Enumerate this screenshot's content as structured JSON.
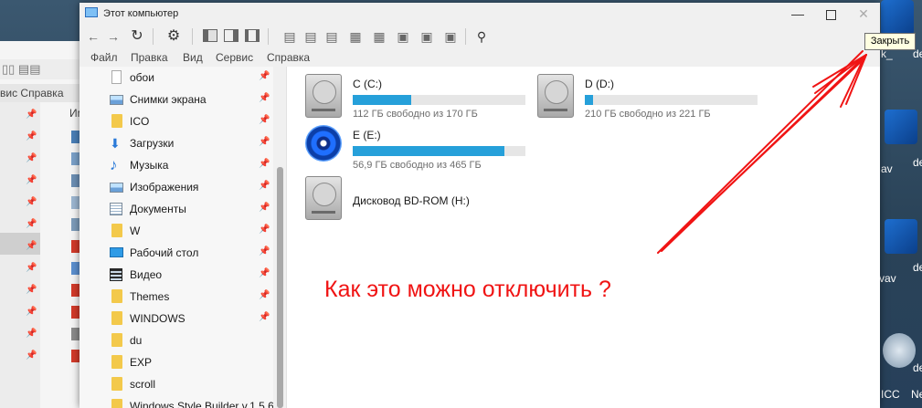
{
  "window": {
    "title": "Этот компьютер"
  },
  "menu": [
    "Файл",
    "Правка",
    "Вид",
    "Сервис",
    "Справка"
  ],
  "background_window": {
    "menu": "вис   Справка",
    "column_fragment": "Им"
  },
  "desktop_labels": [
    "k_",
    "de",
    "de",
    "av",
    "de",
    "vav",
    "de",
    "ICC",
    "Ne"
  ],
  "sidebar": [
    {
      "label": "обои",
      "icon": "blank-file-icon",
      "pinned": true
    },
    {
      "label": "Снимки экрана",
      "icon": "image-folder-icon",
      "pinned": true
    },
    {
      "label": "ICO",
      "icon": "folder-icon",
      "pinned": true
    },
    {
      "label": "Загрузки",
      "icon": "download-arrow-icon",
      "pinned": true
    },
    {
      "label": "Музыка",
      "icon": "music-note-icon",
      "pinned": true
    },
    {
      "label": "Изображения",
      "icon": "image-folder-icon",
      "pinned": true
    },
    {
      "label": "Документы",
      "icon": "document-icon",
      "pinned": true
    },
    {
      "label": "W",
      "icon": "folder-icon",
      "pinned": true
    },
    {
      "label": "Рабочий стол",
      "icon": "desktop-icon",
      "pinned": true
    },
    {
      "label": "Видео",
      "icon": "film-icon",
      "pinned": true
    },
    {
      "label": "Themes",
      "icon": "folder-icon",
      "pinned": true
    },
    {
      "label": "WINDOWS",
      "icon": "folder-icon",
      "pinned": true
    },
    {
      "label": "du",
      "icon": "folder-icon",
      "pinned": false
    },
    {
      "label": "EXP",
      "icon": "folder-icon",
      "pinned": false
    },
    {
      "label": "scroll",
      "icon": "folder-icon",
      "pinned": false
    },
    {
      "label": "Windows Style Builder v.1.5.6.",
      "icon": "folder-icon",
      "pinned": false
    }
  ],
  "drives": [
    {
      "name": "C (C:)",
      "icon": "hard-drive-icon",
      "free_text": "112 ГБ свободно из 170 ГБ",
      "used_fraction": 0.34
    },
    {
      "name": "D (D:)",
      "icon": "hard-drive-icon",
      "free_text": "210 ГБ свободно из 221 ГБ",
      "used_fraction": 0.05
    },
    {
      "name": "E (E:)",
      "icon": "dvd-disc-icon",
      "free_text": "56,9 ГБ свободно из 465 ГБ",
      "used_fraction": 0.88
    },
    {
      "name": "Дисковод BD-ROM (H:)",
      "icon": "hard-drive-icon",
      "free_text": "",
      "used_fraction": null
    }
  ],
  "tooltip": "Закрыть",
  "annotation": {
    "text": "Как это можно отключить ?",
    "color": "#f01414"
  },
  "colors": {
    "progress": "#26a0da",
    "folder": "#f3c94b",
    "annotation": "#f01414"
  }
}
